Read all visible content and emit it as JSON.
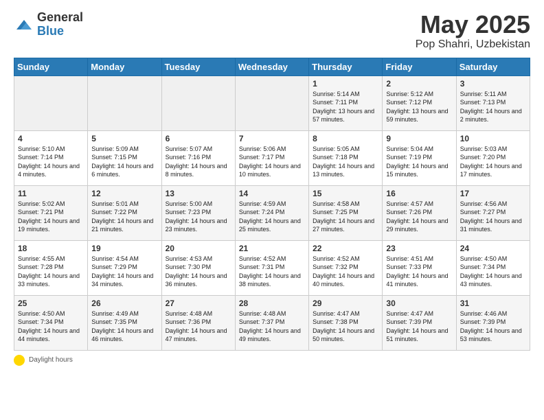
{
  "header": {
    "logo_general": "General",
    "logo_blue": "Blue",
    "title_month": "May 2025",
    "title_location": "Pop Shahri, Uzbekistan"
  },
  "days_of_week": [
    "Sunday",
    "Monday",
    "Tuesday",
    "Wednesday",
    "Thursday",
    "Friday",
    "Saturday"
  ],
  "footer": {
    "daylight_label": "Daylight hours"
  },
  "weeks": [
    [
      {
        "day": "",
        "sunrise": "",
        "sunset": "",
        "daylight": "",
        "empty": true
      },
      {
        "day": "",
        "sunrise": "",
        "sunset": "",
        "daylight": "",
        "empty": true
      },
      {
        "day": "",
        "sunrise": "",
        "sunset": "",
        "daylight": "",
        "empty": true
      },
      {
        "day": "",
        "sunrise": "",
        "sunset": "",
        "daylight": "",
        "empty": true
      },
      {
        "day": "1",
        "sunrise": "Sunrise: 5:14 AM",
        "sunset": "Sunset: 7:11 PM",
        "daylight": "Daylight: 13 hours and 57 minutes.",
        "empty": false
      },
      {
        "day": "2",
        "sunrise": "Sunrise: 5:12 AM",
        "sunset": "Sunset: 7:12 PM",
        "daylight": "Daylight: 13 hours and 59 minutes.",
        "empty": false
      },
      {
        "day": "3",
        "sunrise": "Sunrise: 5:11 AM",
        "sunset": "Sunset: 7:13 PM",
        "daylight": "Daylight: 14 hours and 2 minutes.",
        "empty": false
      }
    ],
    [
      {
        "day": "4",
        "sunrise": "Sunrise: 5:10 AM",
        "sunset": "Sunset: 7:14 PM",
        "daylight": "Daylight: 14 hours and 4 minutes.",
        "empty": false
      },
      {
        "day": "5",
        "sunrise": "Sunrise: 5:09 AM",
        "sunset": "Sunset: 7:15 PM",
        "daylight": "Daylight: 14 hours and 6 minutes.",
        "empty": false
      },
      {
        "day": "6",
        "sunrise": "Sunrise: 5:07 AM",
        "sunset": "Sunset: 7:16 PM",
        "daylight": "Daylight: 14 hours and 8 minutes.",
        "empty": false
      },
      {
        "day": "7",
        "sunrise": "Sunrise: 5:06 AM",
        "sunset": "Sunset: 7:17 PM",
        "daylight": "Daylight: 14 hours and 10 minutes.",
        "empty": false
      },
      {
        "day": "8",
        "sunrise": "Sunrise: 5:05 AM",
        "sunset": "Sunset: 7:18 PM",
        "daylight": "Daylight: 14 hours and 13 minutes.",
        "empty": false
      },
      {
        "day": "9",
        "sunrise": "Sunrise: 5:04 AM",
        "sunset": "Sunset: 7:19 PM",
        "daylight": "Daylight: 14 hours and 15 minutes.",
        "empty": false
      },
      {
        "day": "10",
        "sunrise": "Sunrise: 5:03 AM",
        "sunset": "Sunset: 7:20 PM",
        "daylight": "Daylight: 14 hours and 17 minutes.",
        "empty": false
      }
    ],
    [
      {
        "day": "11",
        "sunrise": "Sunrise: 5:02 AM",
        "sunset": "Sunset: 7:21 PM",
        "daylight": "Daylight: 14 hours and 19 minutes.",
        "empty": false
      },
      {
        "day": "12",
        "sunrise": "Sunrise: 5:01 AM",
        "sunset": "Sunset: 7:22 PM",
        "daylight": "Daylight: 14 hours and 21 minutes.",
        "empty": false
      },
      {
        "day": "13",
        "sunrise": "Sunrise: 5:00 AM",
        "sunset": "Sunset: 7:23 PM",
        "daylight": "Daylight: 14 hours and 23 minutes.",
        "empty": false
      },
      {
        "day": "14",
        "sunrise": "Sunrise: 4:59 AM",
        "sunset": "Sunset: 7:24 PM",
        "daylight": "Daylight: 14 hours and 25 minutes.",
        "empty": false
      },
      {
        "day": "15",
        "sunrise": "Sunrise: 4:58 AM",
        "sunset": "Sunset: 7:25 PM",
        "daylight": "Daylight: 14 hours and 27 minutes.",
        "empty": false
      },
      {
        "day": "16",
        "sunrise": "Sunrise: 4:57 AM",
        "sunset": "Sunset: 7:26 PM",
        "daylight": "Daylight: 14 hours and 29 minutes.",
        "empty": false
      },
      {
        "day": "17",
        "sunrise": "Sunrise: 4:56 AM",
        "sunset": "Sunset: 7:27 PM",
        "daylight": "Daylight: 14 hours and 31 minutes.",
        "empty": false
      }
    ],
    [
      {
        "day": "18",
        "sunrise": "Sunrise: 4:55 AM",
        "sunset": "Sunset: 7:28 PM",
        "daylight": "Daylight: 14 hours and 33 minutes.",
        "empty": false
      },
      {
        "day": "19",
        "sunrise": "Sunrise: 4:54 AM",
        "sunset": "Sunset: 7:29 PM",
        "daylight": "Daylight: 14 hours and 34 minutes.",
        "empty": false
      },
      {
        "day": "20",
        "sunrise": "Sunrise: 4:53 AM",
        "sunset": "Sunset: 7:30 PM",
        "daylight": "Daylight: 14 hours and 36 minutes.",
        "empty": false
      },
      {
        "day": "21",
        "sunrise": "Sunrise: 4:52 AM",
        "sunset": "Sunset: 7:31 PM",
        "daylight": "Daylight: 14 hours and 38 minutes.",
        "empty": false
      },
      {
        "day": "22",
        "sunrise": "Sunrise: 4:52 AM",
        "sunset": "Sunset: 7:32 PM",
        "daylight": "Daylight: 14 hours and 40 minutes.",
        "empty": false
      },
      {
        "day": "23",
        "sunrise": "Sunrise: 4:51 AM",
        "sunset": "Sunset: 7:33 PM",
        "daylight": "Daylight: 14 hours and 41 minutes.",
        "empty": false
      },
      {
        "day": "24",
        "sunrise": "Sunrise: 4:50 AM",
        "sunset": "Sunset: 7:34 PM",
        "daylight": "Daylight: 14 hours and 43 minutes.",
        "empty": false
      }
    ],
    [
      {
        "day": "25",
        "sunrise": "Sunrise: 4:50 AM",
        "sunset": "Sunset: 7:34 PM",
        "daylight": "Daylight: 14 hours and 44 minutes.",
        "empty": false
      },
      {
        "day": "26",
        "sunrise": "Sunrise: 4:49 AM",
        "sunset": "Sunset: 7:35 PM",
        "daylight": "Daylight: 14 hours and 46 minutes.",
        "empty": false
      },
      {
        "day": "27",
        "sunrise": "Sunrise: 4:48 AM",
        "sunset": "Sunset: 7:36 PM",
        "daylight": "Daylight: 14 hours and 47 minutes.",
        "empty": false
      },
      {
        "day": "28",
        "sunrise": "Sunrise: 4:48 AM",
        "sunset": "Sunset: 7:37 PM",
        "daylight": "Daylight: 14 hours and 49 minutes.",
        "empty": false
      },
      {
        "day": "29",
        "sunrise": "Sunrise: 4:47 AM",
        "sunset": "Sunset: 7:38 PM",
        "daylight": "Daylight: 14 hours and 50 minutes.",
        "empty": false
      },
      {
        "day": "30",
        "sunrise": "Sunrise: 4:47 AM",
        "sunset": "Sunset: 7:39 PM",
        "daylight": "Daylight: 14 hours and 51 minutes.",
        "empty": false
      },
      {
        "day": "31",
        "sunrise": "Sunrise: 4:46 AM",
        "sunset": "Sunset: 7:39 PM",
        "daylight": "Daylight: 14 hours and 53 minutes.",
        "empty": false
      }
    ]
  ]
}
